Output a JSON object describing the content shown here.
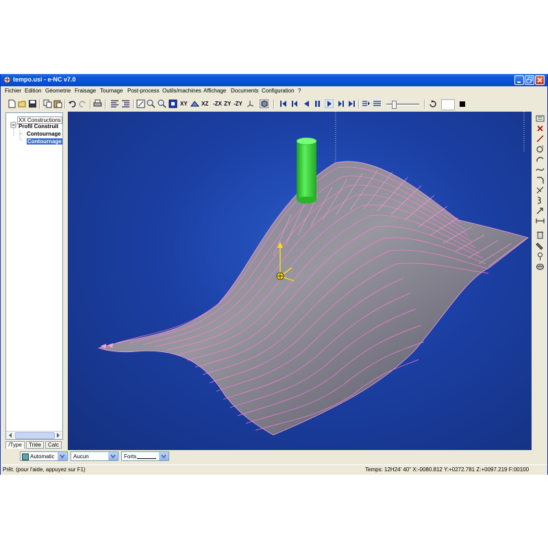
{
  "window": {
    "title": "tempo.usi - e-NC v7.0"
  },
  "menu": [
    "Fichier",
    "Edition",
    "Géometrie",
    "Fraisage",
    "Tournage",
    "Post-process",
    "Outils/machines",
    "Affichage",
    "Documents",
    "Configuration",
    "?"
  ],
  "toolbar": {
    "views": [
      "XY",
      "XZ",
      "-ZX",
      "ZY",
      "-ZY"
    ]
  },
  "tree": {
    "root": "XX Constructions",
    "group": "Profil Construit",
    "children": [
      "Contournage",
      "Contournage"
    ]
  },
  "tabs": [
    "/Type",
    "Triée",
    "Calc"
  ],
  "bottom": {
    "mode": "Automatic",
    "filter": "Aucun",
    "weight": "Forts"
  },
  "status": {
    "message": "Prêt. (pour l'aide, appuyez sur F1)",
    "coords": "Temps: 12H24' 40\" X:-0080.812 Y:+0272.781 Z:+0097.219 F:00100"
  },
  "colors": {
    "viewport_bg": "#1b3fa3",
    "surface": "#8a8898",
    "toolpath": "#ff7fd0",
    "tool": "#3fd43f",
    "titlebar": "#0a5ad6"
  }
}
